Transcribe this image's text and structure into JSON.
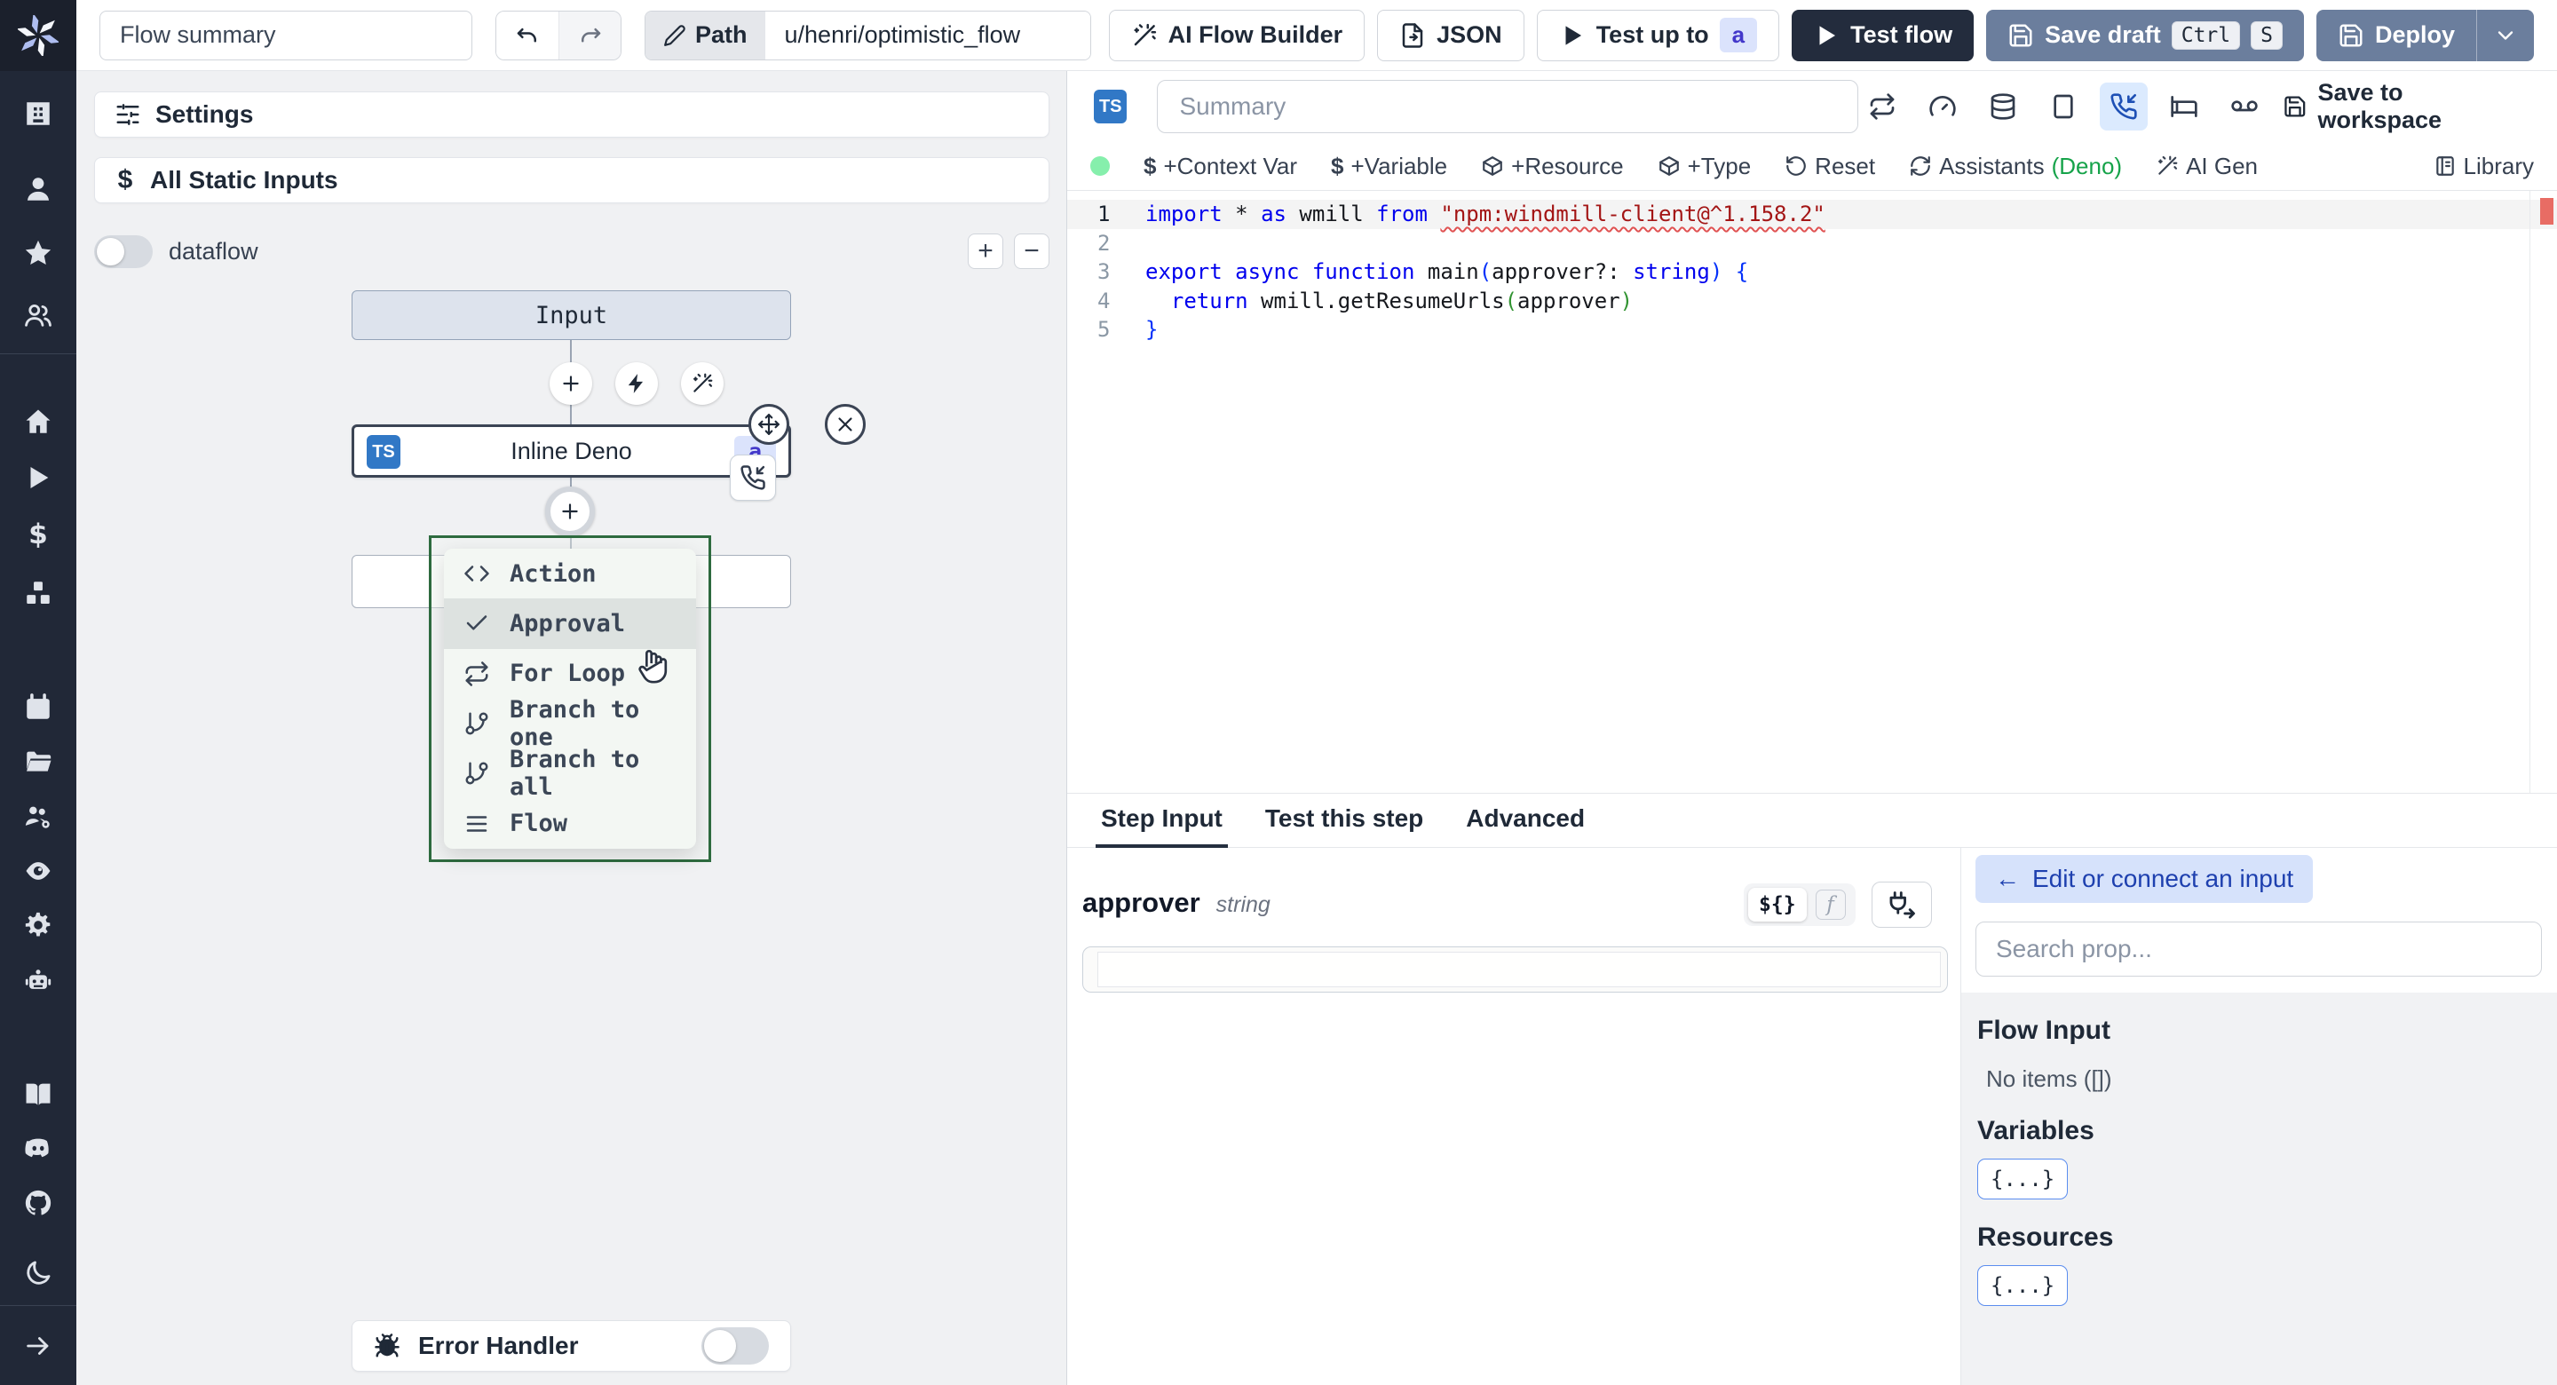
{
  "topbar": {
    "flow_summary_value": "Flow summary",
    "path_label": "Path",
    "path_value": "u/henri/optimistic_flow",
    "ai_flow_builder": "AI Flow Builder",
    "json": "JSON",
    "test_up_to": "Test up to",
    "test_up_to_badge": "a",
    "test_flow": "Test flow",
    "save_draft": "Save draft",
    "save_draft_keys": [
      "Ctrl",
      "S"
    ],
    "deploy": "Deploy"
  },
  "flow_panel": {
    "settings": "Settings",
    "all_static_inputs": "All Static Inputs",
    "static_inputs_icon_glyph": "$",
    "dataflow_label": "dataflow",
    "zoom_in": "+",
    "zoom_out": "−",
    "input_node": "Input",
    "step_node": {
      "lang_badge": "TS",
      "label": "Inline Deno",
      "id_badge": "a"
    },
    "error_handler": "Error Handler"
  },
  "insert_menu": {
    "items": [
      {
        "icon": "code",
        "label": "Action",
        "hover": false
      },
      {
        "icon": "check",
        "label": "Approval",
        "hover": true
      },
      {
        "icon": "repeat",
        "label": "For Loop",
        "hover": false
      },
      {
        "icon": "git-branch",
        "label": "Branch to one",
        "hover": false
      },
      {
        "icon": "git-branch",
        "label": "Branch to all",
        "hover": false
      },
      {
        "icon": "menu-lines",
        "label": "Flow",
        "hover": false
      }
    ]
  },
  "editor_panel": {
    "lang_badge": "TS",
    "summary_placeholder": "Summary",
    "save_to_workspace": "Save to workspace",
    "toolbar": {
      "context_var": "+Context Var",
      "variable": "+Variable",
      "resource": "+Resource",
      "type": "+Type",
      "reset": "Reset",
      "assistants": "Assistants",
      "assistants_lang": "(Deno)",
      "ai_gen": "AI Gen",
      "library": "Library",
      "dollar_glyph": "$"
    },
    "code": {
      "lines": [
        [
          {
            "c": "kw",
            "t": "import"
          },
          {
            "c": "pl",
            "t": " * "
          },
          {
            "c": "kw",
            "t": "as"
          },
          {
            "c": "pl",
            "t": " wmill "
          },
          {
            "c": "kw",
            "t": "from"
          },
          {
            "c": "pl",
            "t": " "
          },
          {
            "c": "str",
            "t": "\"npm:windmill-client@^1.158.2\""
          }
        ],
        [],
        [
          {
            "c": "kw",
            "t": "export"
          },
          {
            "c": "pl",
            "t": " "
          },
          {
            "c": "kw",
            "t": "async"
          },
          {
            "c": "pl",
            "t": " "
          },
          {
            "c": "kw",
            "t": "function"
          },
          {
            "c": "pl",
            "t": " main"
          },
          {
            "c": "pb",
            "t": "("
          },
          {
            "c": "pl",
            "t": "approver?: "
          },
          {
            "c": "kw",
            "t": "string"
          },
          {
            "c": "pb",
            "t": ")"
          },
          {
            "c": "pl",
            "t": " "
          },
          {
            "c": "pb",
            "t": "{"
          }
        ],
        [
          {
            "c": "pl",
            "t": "  "
          },
          {
            "c": "kw",
            "t": "return"
          },
          {
            "c": "pl",
            "t": " wmill.getResumeUrls"
          },
          {
            "c": "pg",
            "t": "("
          },
          {
            "c": "pl",
            "t": "approver"
          },
          {
            "c": "pg",
            "t": ")"
          }
        ],
        [
          {
            "c": "pb",
            "t": "}"
          }
        ]
      ]
    }
  },
  "step_panel": {
    "tabs": [
      {
        "label": "Step Input",
        "active": true
      },
      {
        "label": "Test this step",
        "active": false
      },
      {
        "label": "Advanced",
        "active": false
      }
    ],
    "field": {
      "name": "approver",
      "type": "string",
      "expr_toggle": "${}",
      "fn_toggle": "f",
      "value": ""
    }
  },
  "props_panel": {
    "edit_connect": "Edit or connect an input",
    "back_arrow": "←",
    "search_placeholder": "Search prop...",
    "sections": [
      {
        "title": "Flow Input",
        "empty": "No items ([])"
      },
      {
        "title": "Variables",
        "badge": "{...}"
      },
      {
        "title": "Resources",
        "badge": "{...}"
      }
    ]
  },
  "colors": {
    "ts_badge_blue": "#3178c6",
    "menu_border_green": "#2e6b3f",
    "error_ruler_red": "#e86c64",
    "green_status_dot": "#86efac",
    "deno_green": "#16a34a",
    "slate_button": "#6b7e9d",
    "dark_button": "#232c3d",
    "indigo_badge": "#4338ca",
    "sidebar_dark": "#212837",
    "canvas_gray": "#f0f1f3"
  }
}
